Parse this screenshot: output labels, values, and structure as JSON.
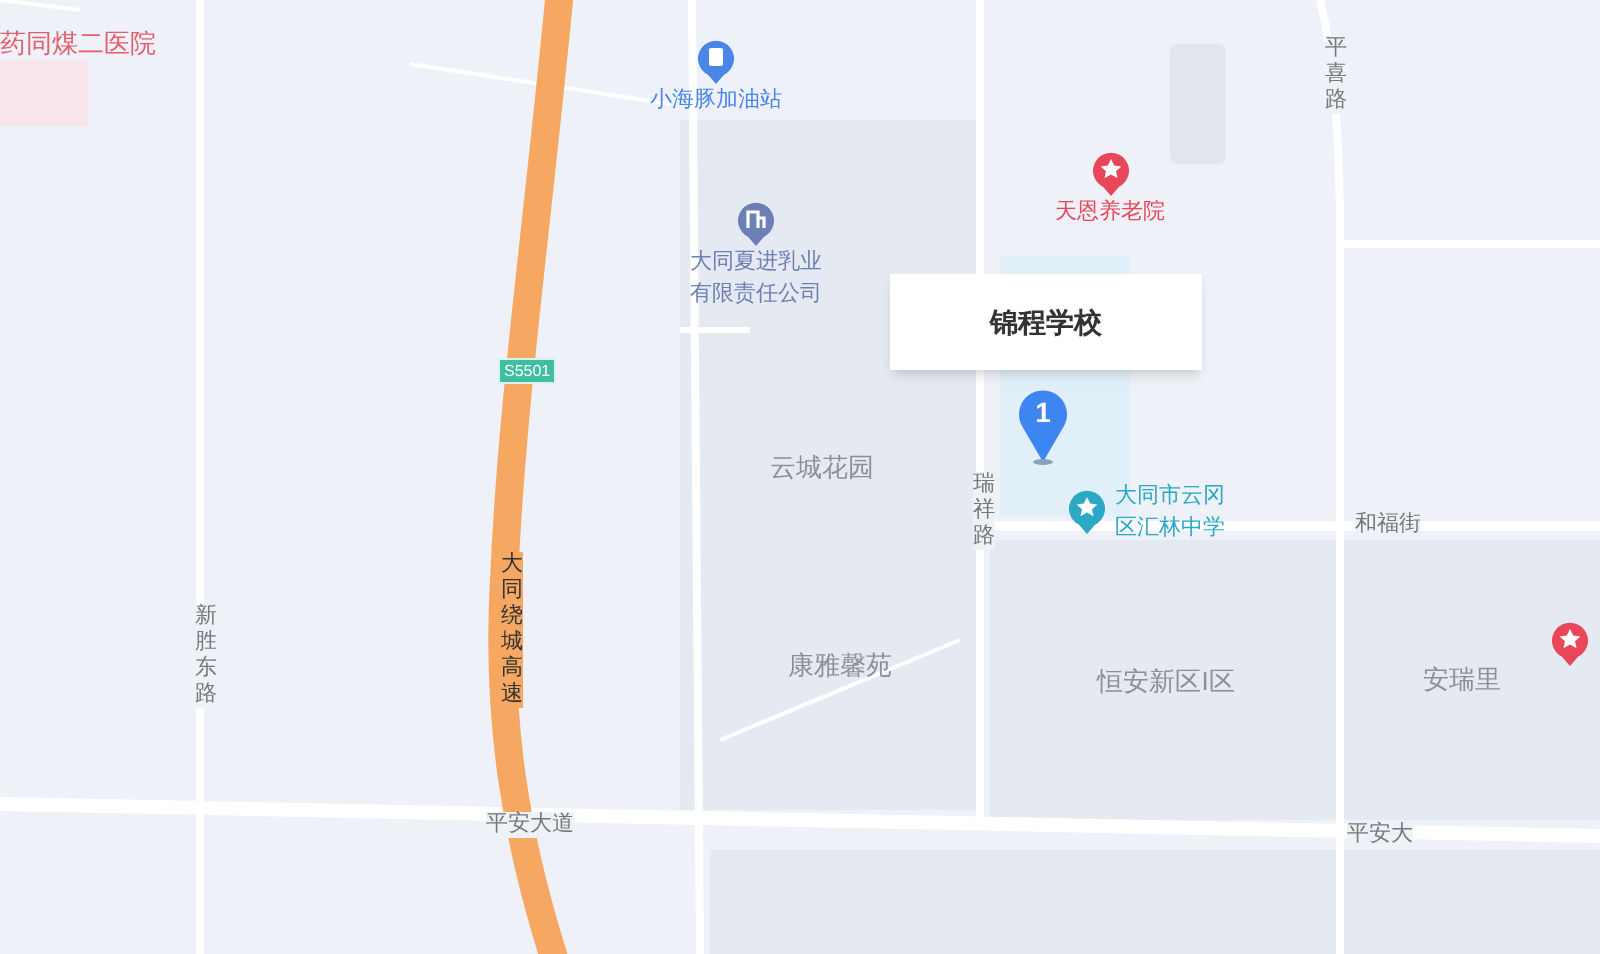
{
  "map": {
    "popup": {
      "title": "锦程学校"
    },
    "marker": {
      "label": "1"
    },
    "shield": {
      "label": "S5501"
    },
    "labels": [
      {
        "kind": "place",
        "lines": [
          "药同煤二医院"
        ],
        "color": "#e0606e"
      },
      {
        "kind": "station",
        "lines": [
          "小海豚加油站"
        ],
        "color": "#4a86e8"
      },
      {
        "kind": "company",
        "lines": [
          "大同夏进乳业",
          "有限责任公司"
        ],
        "color": "#6d7fb5"
      },
      {
        "kind": "care",
        "lines": [
          "天恩养老院"
        ],
        "color": "#e8475a"
      },
      {
        "kind": "school",
        "lines": [
          "大同市云冈",
          "区汇林中学"
        ],
        "color": "#2aa8c4"
      },
      {
        "kind": "pin",
        "color": "#e8475a"
      },
      {
        "kind": "area",
        "lines": [
          "云城花园"
        ]
      },
      {
        "kind": "area",
        "lines": [
          "康雅馨苑"
        ]
      },
      {
        "kind": "area",
        "lines": [
          "恒安新区I区"
        ]
      },
      {
        "kind": "area",
        "lines": [
          "安瑞里"
        ]
      },
      {
        "kind": "road",
        "lines": [
          "平喜路"
        ]
      },
      {
        "kind": "road",
        "lines": [
          "瑞祥路"
        ]
      },
      {
        "kind": "road",
        "lines": [
          "新胜东路"
        ]
      },
      {
        "kind": "highway",
        "lines": [
          "大同绕城高速"
        ]
      },
      {
        "kind": "road",
        "lines": [
          "和福街"
        ]
      },
      {
        "kind": "road",
        "lines": [
          "平安大道"
        ]
      },
      {
        "kind": "road",
        "lines": [
          "平安大"
        ]
      }
    ]
  }
}
